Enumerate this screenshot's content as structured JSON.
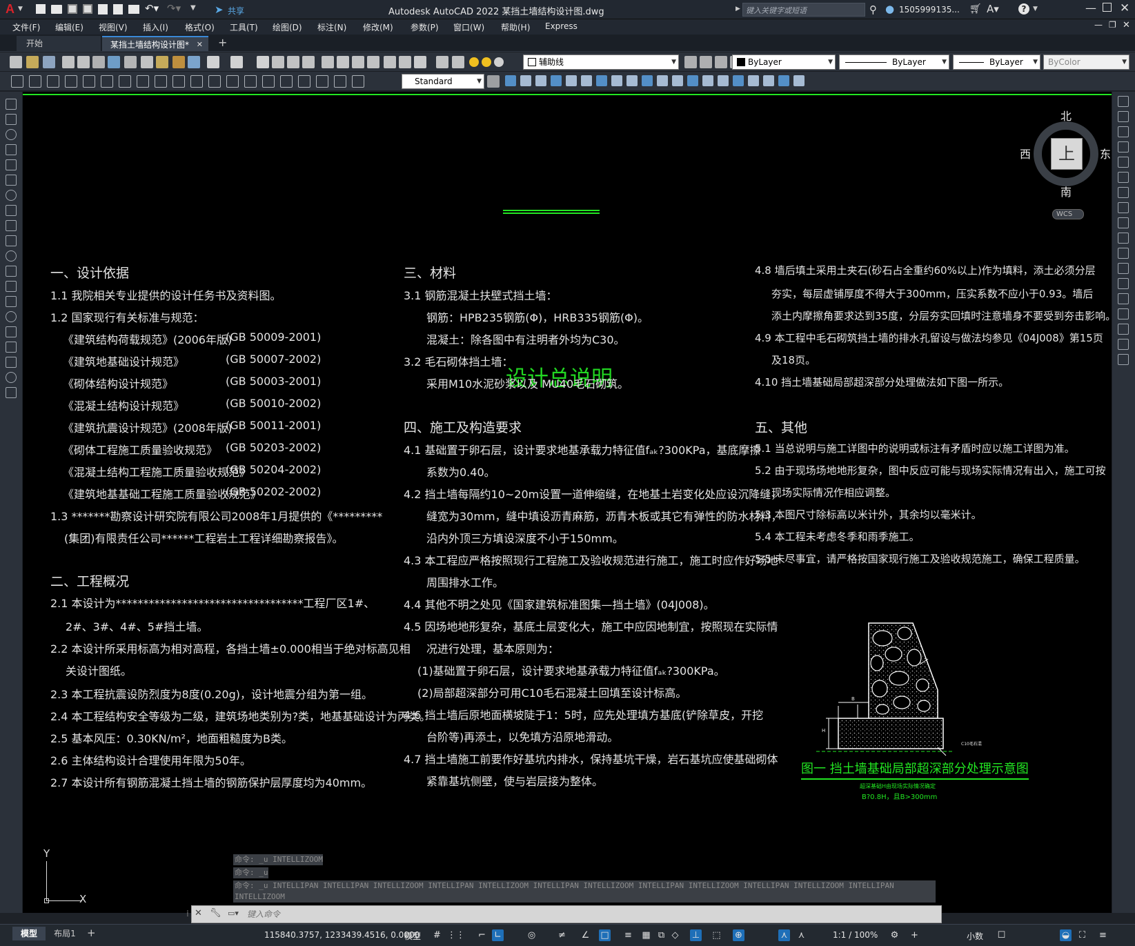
{
  "titlebar": {
    "app_logo": "A",
    "share": "共享",
    "title": "Autodesk AutoCAD 2022    某挡土墙结构设计图.dwg",
    "search_placeholder": "键入关键字或短语",
    "user": "1505999135...",
    "help": "?"
  },
  "menu": [
    "文件(F)",
    "编辑(E)",
    "视图(V)",
    "插入(I)",
    "格式(O)",
    "工具(T)",
    "绘图(D)",
    "标注(N)",
    "修改(M)",
    "参数(P)",
    "窗口(W)",
    "帮助(H)",
    "Express"
  ],
  "file_tabs": {
    "start": "开始",
    "active": "某挡土墙结构设计图*",
    "close": "✕",
    "add": "+"
  },
  "toolbar": {
    "layer": "辅助线",
    "color": "ByLayer",
    "linetype": "ByLayer",
    "lineweight": "ByLayer",
    "plotstyle": "ByColor",
    "textstyle": "Standard"
  },
  "viewcube": {
    "north": "北",
    "south": "南",
    "east": "东",
    "west": "西",
    "top": "上",
    "wcs": "WCS"
  },
  "ucs": {
    "y": "Y",
    "x": "X"
  },
  "drawing": {
    "title": "设计总说明",
    "col1": [
      "一、设计依据",
      "1.1  我院相关专业提供的设计任务书及资料图。",
      "1.2  国家现行有关标准与规范：",
      "《建筑结构荷载规范》(2006年版)",
      "《建筑地基础设计规范》",
      "《砌体结构设计规范》",
      "《混凝土结构设计规范》",
      "《建筑抗震设计规范》(2008年版)",
      "《砌体工程施工质量验收规范》",
      "《混凝土结构工程施工质量验收规范》",
      "《建筑地基基础工程施工质量验收规范》",
      "1.3  *******勘察设计研究院有限公司2008年1月提供的《*********",
      "(集团)有限责任公司******工程岩土工程详细勘察报告》。",
      "二、工程概况",
      "2.1  本设计为**********************************工程厂区1#、",
      "2#、3#、4#、5#挡土墙。",
      "2.2  本设计所采用标高为相对高程，各挡土墙±0.000相当于绝对标高见相",
      "关设计图纸。",
      "2.3  本工程抗震设防烈度为8度(0.20g)，设计地震分组为第一组。",
      "2.4  本工程结构安全等级为二级，建筑场地类别为?类，地基基础设计为丙类。",
      "2.5  基本风压：0.30KN/m²，地面粗糙度为B类。",
      "2.6  主体结构设计合理使用年限为50年。",
      "2.7  本设计所有钢筋混凝土挡土墙的钢筋保护层厚度均为40mm。"
    ],
    "codes": [
      "(GB 50009-2001)",
      "(GB 50007-2002)",
      "(GB 50003-2001)",
      "(GB 50010-2002)",
      "(GB 50011-2001)",
      "(GB 50203-2002)",
      "(GB 50204-2002)",
      "(GB 50202-2002)"
    ],
    "col2": [
      "三、材料",
      "3.1  钢筋混凝土扶壁式挡土墙：",
      "钢筋：HPB235钢筋(Φ)，HRB335钢筋(Φ)。",
      "混凝土：除各图中有注明者外均为C30。",
      "3.2  毛石砌体挡土墙：",
      "采用M10水泥砂浆以及 MU40毛石砌筑。",
      "四、施工及构造要求",
      "4.1  基础置于卵石层，设计要求地基承载力特征值fₐₖ?300KPa，基底摩擦",
      "系数为0.40。",
      "4.2  挡土墙每隔约10~20m设置一道伸缩缝，在地基土岩变化处应设沉降缝，",
      "缝宽为30mm，缝中填设沥青麻筋，沥青木板或其它有弹性的防水材料，",
      "沿内外顶三方填设深度不小于150mm。",
      "4.3  本工程应严格按照现行工程施工及验收规范进行施工，施工时应作好场地",
      "周围排水工作。",
      "4.4  其他不明之处见《国家建筑标准图集—挡土墙》(04J008)。",
      "4.5  因场地地形复杂，基底土层变化大，施工中应因地制宜，按照现在实际情",
      "况进行处理，基本原则为：",
      "(1)基础置于卵石层，设计要求地基承载力特征值fₐₖ?300KPa。",
      "(2)局部超深部分可用C10毛石混凝土回填至设计标高。",
      "4.6  挡土墙后原地面横坡陡于1：5时，应先处理填方基底(铲除草皮，开挖",
      "台阶等)再添土，以免填方沿原地滑动。",
      "4.7  挡土墙施工前要作好基坑内排水，保持基坑干燥，岩石基坑应使基础砌体",
      "紧靠基坑侧壁，使与岩层接为整体。"
    ],
    "col3": [
      "4.8  墙后填土采用土夹石(砂石占全重约60%以上)作为填料，添土必须分层",
      "夯实，每层虚铺厚度不得大于300mm，压实系数不应小于0.93。墙后",
      "添土内摩擦角要求达到35度，分层夯实回填时注意墙身不要受到夯击影响。",
      "4.9  本工程中毛石砌筑挡土墙的排水孔留设与做法均参见《04J008》第15页",
      "及18页。",
      "4.10  挡土墙基础局部超深部分处理做法如下图一所示。",
      "五、其他",
      "5.1  当总说明与施工详图中的说明或标注有矛盾时应以施工详图为准。",
      "5.2  由于现场场地地形复杂，图中反应可能与现场实际情况有出入，施工可按",
      "现场实际情况作相应调整。",
      "5.3  本图尺寸除标高以米计外，其余均以毫米计。",
      "5.4  本工程未考虑冬季和雨季施工。",
      "5.5  未尽事宜，请严格按国家现行施工及验收规范施工，确保工程质量。"
    ],
    "figure": {
      "caption": "图一  挡土墙基础局部超深部分处理示意图",
      "note1": "超深基础H由现场实际情况确定",
      "note2": "B?0.8H，且B>300mm",
      "label_c10": "C10毛石混",
      "label_b": "B",
      "label_h": "H"
    }
  },
  "commands": {
    "line1": "命令: _u INTELLIZOOM",
    "line2": "命令: _u",
    "line3": "命令: _u INTELLIPAN INTELLIPAN INTELLIZOOM INTELLIPAN INTELLIZOOM INTELLIPAN INTELLIZOOM INTELLIPAN INTELLIZOOM INTELLIPAN INTELLIZOOM INTELLIPAN",
    "line4": "INTELLIZOOM",
    "placeholder": "键入命令"
  },
  "status": {
    "model_tab": "模型",
    "layout_tab": "布局1",
    "add": "+",
    "coords": "115840.3757, 1233439.4516, 0.0000",
    "space": "模型",
    "scale": "1:1 / 100%",
    "units": "小数"
  }
}
